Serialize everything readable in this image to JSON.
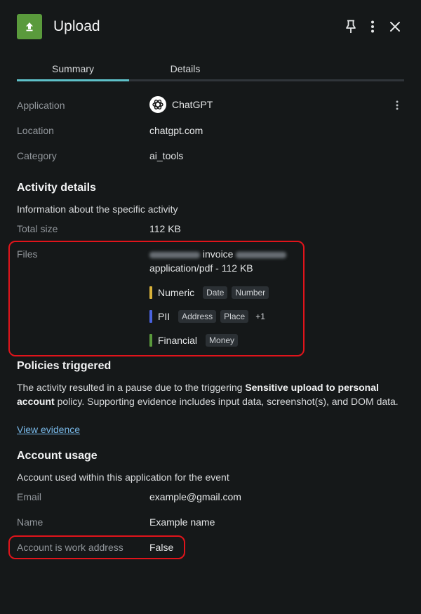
{
  "header": {
    "title": "Upload",
    "icons": [
      "upload-icon",
      "pin-icon",
      "more-vertical-icon",
      "close-icon"
    ],
    "icon_color": "#5a9a3c"
  },
  "tabs": [
    {
      "label": "Summary",
      "active": true
    },
    {
      "label": "Details",
      "active": false
    }
  ],
  "summary": {
    "application_label": "Application",
    "application_value": "ChatGPT",
    "location_label": "Location",
    "location_value": "chatgpt.com",
    "category_label": "Category",
    "category_value": "ai_tools"
  },
  "activity": {
    "title": "Activity details",
    "description": "Information about the specific activity",
    "total_size_label": "Total size",
    "total_size_value": "112 KB",
    "files_label": "Files",
    "file_name": "invoice",
    "file_meta": "application/pdf - 112 KB",
    "data_types": [
      {
        "name": "Numeric",
        "color": "#d9b23a",
        "tags": [
          "Date",
          "Number"
        ],
        "more": ""
      },
      {
        "name": "PII",
        "color": "#4a63e0",
        "tags": [
          "Address",
          "Place"
        ],
        "more": "+1"
      },
      {
        "name": "Financial",
        "color": "#5a9a3c",
        "tags": [
          "Money"
        ],
        "more": ""
      }
    ]
  },
  "policies": {
    "title": "Policies triggered",
    "text_before": "The activity resulted in a pause due to the triggering ",
    "policy_name": "Sensitive upload to personal account",
    "text_after": " policy. Supporting evidence includes input data, screenshot(s), and DOM data.",
    "link_label": "View evidence"
  },
  "account": {
    "title": "Account usage",
    "description": "Account used within this application for the event",
    "email_label": "Email",
    "email_value": "example@gmail.com",
    "name_label": "Name",
    "name_value": "Example name",
    "work_label": "Account is work address",
    "work_value": "False"
  },
  "colors": {
    "background": "#151819",
    "accent_tab": "#5ec1c9",
    "highlight": "#e0141b",
    "link": "#78b8e8"
  }
}
